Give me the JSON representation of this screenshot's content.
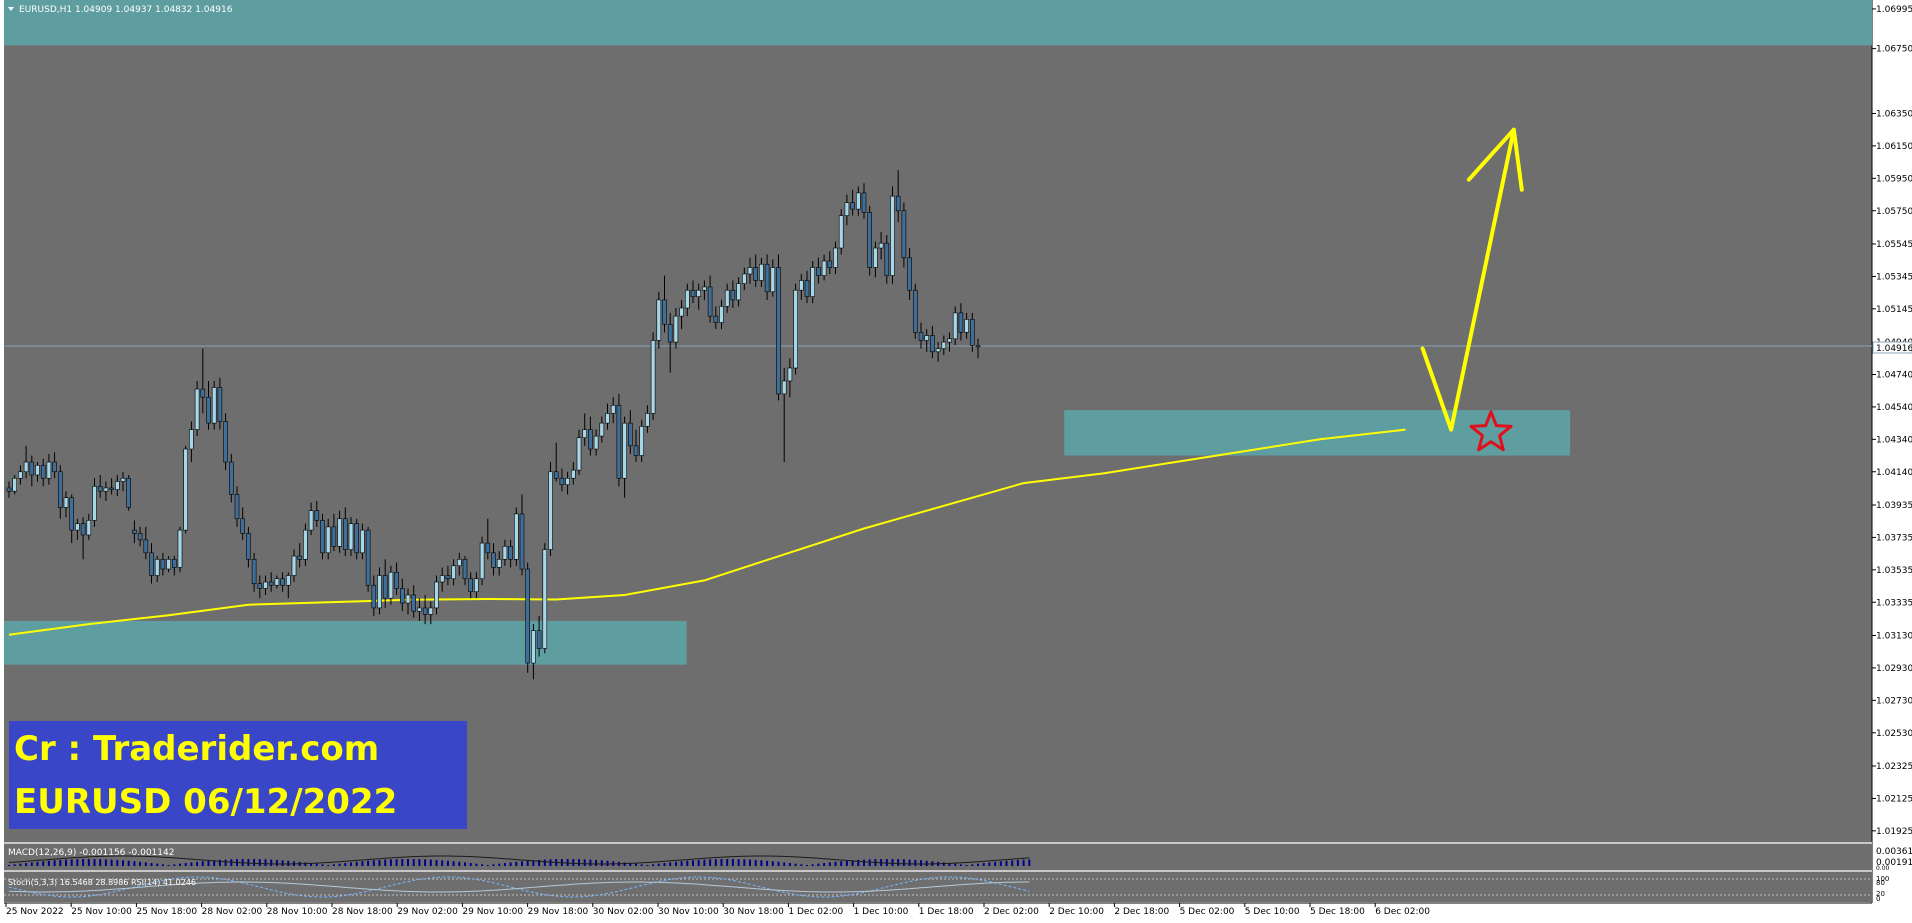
{
  "chart_data": {
    "type": "candlestick",
    "symbol_header": "EURUSD,H1  1.04909 1.04937 1.04832 1.04916",
    "current_price": 1.04916,
    "current_price_label": "1.04916",
    "ylim": [
      1.0185,
      1.0705
    ],
    "y_ticks": [
      "1.06995",
      "1.06750",
      "1.06350",
      "1.06150",
      "1.05950",
      "1.05750",
      "1.05545",
      "1.05345",
      "1.05145",
      "1.04940",
      "1.04740",
      "1.04540",
      "1.04340",
      "1.04140",
      "1.03935",
      "1.03735",
      "1.03535",
      "1.03335",
      "1.03130",
      "1.02930",
      "1.02730",
      "1.02530",
      "1.02325",
      "1.02125",
      "1.01925"
    ],
    "x_ticks": [
      "25 Nov 2022",
      "25 Nov 10:00",
      "25 Nov 18:00",
      "28 Nov 02:00",
      "28 Nov 10:00",
      "28 Nov 18:00",
      "29 Nov 02:00",
      "29 Nov 10:00",
      "29 Nov 18:00",
      "30 Nov 02:00",
      "30 Nov 10:00",
      "30 Nov 18:00",
      "1 Dec 02:00",
      "1 Dec 10:00",
      "1 Dec 18:00",
      "2 Dec 02:00",
      "2 Dec 10:00",
      "2 Dec 18:00",
      "5 Dec 02:00",
      "5 Dec 10:00",
      "5 Dec 18:00",
      "6 Dec 02:00"
    ],
    "bars_total": 180,
    "candles": [
      [
        1.0404,
        1.0408,
        1.0398,
        1.0402
      ],
      [
        1.0402,
        1.0412,
        1.04,
        1.041
      ],
      [
        1.041,
        1.0418,
        1.0406,
        1.0414
      ],
      [
        1.0414,
        1.043,
        1.041,
        1.042
      ],
      [
        1.042,
        1.0424,
        1.0405,
        1.0412
      ],
      [
        1.0412,
        1.042,
        1.0408,
        1.0418
      ],
      [
        1.0418,
        1.0422,
        1.0405,
        1.041
      ],
      [
        1.041,
        1.0425,
        1.0406,
        1.042
      ],
      [
        1.042,
        1.0426,
        1.041,
        1.0414
      ],
      [
        1.0414,
        1.0418,
        1.0385,
        1.0392
      ],
      [
        1.0392,
        1.0402,
        1.0386,
        1.0398
      ],
      [
        1.0398,
        1.04,
        1.037,
        1.0378
      ],
      [
        1.0378,
        1.0385,
        1.0372,
        1.0382
      ],
      [
        1.0382,
        1.0386,
        1.036,
        1.0375
      ],
      [
        1.0375,
        1.0388,
        1.0372,
        1.0384
      ],
      [
        1.0384,
        1.041,
        1.038,
        1.0405
      ],
      [
        1.0405,
        1.0412,
        1.0398,
        1.0402
      ],
      [
        1.0402,
        1.0408,
        1.0396,
        1.0404
      ],
      [
        1.0404,
        1.041,
        1.04,
        1.0403
      ],
      [
        1.0403,
        1.0412,
        1.0399,
        1.0408
      ],
      [
        1.0408,
        1.0414,
        1.0402,
        1.041
      ],
      [
        1.041,
        1.0412,
        1.039,
        1.0392
      ],
      [
        1.0378,
        1.0384,
        1.037,
        1.0376
      ],
      [
        1.0376,
        1.038,
        1.0368,
        1.0372
      ],
      [
        1.0372,
        1.038,
        1.036,
        1.0364
      ],
      [
        1.0364,
        1.037,
        1.0345,
        1.035
      ],
      [
        1.035,
        1.0362,
        1.0346,
        1.036
      ],
      [
        1.036,
        1.0364,
        1.035,
        1.0354
      ],
      [
        1.0354,
        1.0362,
        1.0352,
        1.036
      ],
      [
        1.036,
        1.0362,
        1.035,
        1.0355
      ],
      [
        1.0355,
        1.038,
        1.0352,
        1.0378
      ],
      [
        1.0378,
        1.043,
        1.0376,
        1.0428
      ],
      [
        1.0428,
        1.0445,
        1.042,
        1.044
      ],
      [
        1.044,
        1.047,
        1.0436,
        1.0465
      ],
      [
        1.0465,
        1.049,
        1.045,
        1.046
      ],
      [
        1.046,
        1.047,
        1.044,
        1.0444
      ],
      [
        1.0444,
        1.047,
        1.044,
        1.0466
      ],
      [
        1.0466,
        1.0472,
        1.044,
        1.0445
      ],
      [
        1.0445,
        1.045,
        1.0415,
        1.042
      ],
      [
        1.042,
        1.0425,
        1.0395,
        1.04
      ],
      [
        1.04,
        1.0405,
        1.038,
        1.0385
      ],
      [
        1.0385,
        1.0392,
        1.0372,
        1.0376
      ],
      [
        1.0376,
        1.038,
        1.0355,
        1.036
      ],
      [
        1.036,
        1.0364,
        1.034,
        1.0345
      ],
      [
        1.0345,
        1.035,
        1.0336,
        1.0342
      ],
      [
        1.0342,
        1.035,
        1.0338,
        1.0346
      ],
      [
        1.0346,
        1.0352,
        1.034,
        1.0344
      ],
      [
        1.0344,
        1.035,
        1.0342,
        1.0348
      ],
      [
        1.0348,
        1.0352,
        1.034,
        1.0344
      ],
      [
        1.0344,
        1.0352,
        1.0336,
        1.035
      ],
      [
        1.035,
        1.0366,
        1.0346,
        1.0362
      ],
      [
        1.0362,
        1.037,
        1.0355,
        1.036
      ],
      [
        1.036,
        1.0382,
        1.0356,
        1.0378
      ],
      [
        1.0378,
        1.0395,
        1.0375,
        1.039
      ],
      [
        1.039,
        1.0396,
        1.038,
        1.0384
      ],
      [
        1.0384,
        1.0388,
        1.036,
        1.0364
      ],
      [
        1.0364,
        1.0385,
        1.036,
        1.038
      ],
      [
        1.038,
        1.0388,
        1.0365,
        1.0368
      ],
      [
        1.0368,
        1.039,
        1.0364,
        1.0385
      ],
      [
        1.0385,
        1.0392,
        1.0362,
        1.0366
      ],
      [
        1.0366,
        1.0386,
        1.0362,
        1.0382
      ],
      [
        1.0382,
        1.0385,
        1.036,
        1.0364
      ],
      [
        1.0364,
        1.0382,
        1.036,
        1.0378
      ],
      [
        1.0378,
        1.038,
        1.034,
        1.0344
      ],
      [
        1.0344,
        1.035,
        1.0325,
        1.033
      ],
      [
        1.033,
        1.0355,
        1.0326,
        1.035
      ],
      [
        1.035,
        1.036,
        1.033,
        1.0336
      ],
      [
        1.0336,
        1.0356,
        1.0332,
        1.0352
      ],
      [
        1.0352,
        1.0358,
        1.0338,
        1.0342
      ],
      [
        1.0342,
        1.0348,
        1.0328,
        1.0333
      ],
      [
        1.0333,
        1.0342,
        1.0326,
        1.0338
      ],
      [
        1.0338,
        1.0344,
        1.0324,
        1.0328
      ],
      [
        1.0328,
        1.0336,
        1.0322,
        1.033
      ],
      [
        1.033,
        1.0338,
        1.032,
        1.0326
      ],
      [
        1.0326,
        1.0334,
        1.032,
        1.033
      ],
      [
        1.033,
        1.035,
        1.0326,
        1.0346
      ],
      [
        1.0346,
        1.0355,
        1.034,
        1.035
      ],
      [
        1.035,
        1.0356,
        1.0344,
        1.0348
      ],
      [
        1.0348,
        1.036,
        1.0344,
        1.0356
      ],
      [
        1.0356,
        1.0364,
        1.035,
        1.036
      ],
      [
        1.036,
        1.0362,
        1.0344,
        1.0348
      ],
      [
        1.0348,
        1.0352,
        1.0336,
        1.034
      ],
      [
        1.034,
        1.0352,
        1.0336,
        1.0348
      ],
      [
        1.0348,
        1.0374,
        1.0344,
        1.037
      ],
      [
        1.037,
        1.0385,
        1.036,
        1.0364
      ],
      [
        1.0364,
        1.037,
        1.035,
        1.0355
      ],
      [
        1.0355,
        1.0365,
        1.035,
        1.036
      ],
      [
        1.036,
        1.0372,
        1.0356,
        1.0368
      ],
      [
        1.0368,
        1.0372,
        1.0355,
        1.036
      ],
      [
        1.036,
        1.0392,
        1.0356,
        1.0388
      ],
      [
        1.0388,
        1.04,
        1.035,
        1.0354
      ],
      [
        1.0354,
        1.0358,
        1.029,
        1.0296
      ],
      [
        1.0296,
        1.032,
        1.0286,
        1.0316
      ],
      [
        1.0316,
        1.0325,
        1.03,
        1.0305
      ],
      [
        1.0305,
        1.037,
        1.0302,
        1.0366
      ],
      [
        1.0366,
        1.042,
        1.0362,
        1.0414
      ],
      [
        1.0414,
        1.0432,
        1.0408,
        1.041
      ],
      [
        1.041,
        1.0416,
        1.0402,
        1.0406
      ],
      [
        1.0406,
        1.0414,
        1.04,
        1.041
      ],
      [
        1.041,
        1.042,
        1.0406,
        1.0415
      ],
      [
        1.0415,
        1.044,
        1.0412,
        1.0435
      ],
      [
        1.0435,
        1.045,
        1.043,
        1.044
      ],
      [
        1.044,
        1.0448,
        1.0424,
        1.0428
      ],
      [
        1.0428,
        1.044,
        1.0424,
        1.0436
      ],
      [
        1.0436,
        1.0448,
        1.0432,
        1.0444
      ],
      [
        1.0444,
        1.0456,
        1.044,
        1.045
      ],
      [
        1.045,
        1.046,
        1.0444,
        1.0455
      ],
      [
        1.0455,
        1.0462,
        1.0405,
        1.041
      ],
      [
        1.041,
        1.0448,
        1.0398,
        1.0444
      ],
      [
        1.0444,
        1.0452,
        1.0425,
        1.043
      ],
      [
        1.043,
        1.044,
        1.042,
        1.0424
      ],
      [
        1.0424,
        1.0446,
        1.042,
        1.0442
      ],
      [
        1.0442,
        1.0455,
        1.0438,
        1.045
      ],
      [
        1.045,
        1.05,
        1.0446,
        1.0495
      ],
      [
        1.0495,
        1.0525,
        1.049,
        1.052
      ],
      [
        1.052,
        1.0535,
        1.05,
        1.0505
      ],
      [
        1.0505,
        1.0512,
        1.0475,
        1.0494
      ],
      [
        1.0494,
        1.0515,
        1.049,
        1.051
      ],
      [
        1.051,
        1.052,
        1.0502,
        1.0515
      ],
      [
        1.0515,
        1.053,
        1.051,
        1.0526
      ],
      [
        1.0526,
        1.0532,
        1.0518,
        1.0522
      ],
      [
        1.0522,
        1.053,
        1.0514,
        1.0526
      ],
      [
        1.0526,
        1.0532,
        1.052,
        1.0528
      ],
      [
        1.0528,
        1.0535,
        1.0506,
        1.051
      ],
      [
        1.051,
        1.0516,
        1.0502,
        1.0506
      ],
      [
        1.0506,
        1.052,
        1.0502,
        1.0516
      ],
      [
        1.0516,
        1.053,
        1.0512,
        1.0526
      ],
      [
        1.0526,
        1.0532,
        1.0515,
        1.052
      ],
      [
        1.052,
        1.0534,
        1.0516,
        1.053
      ],
      [
        1.053,
        1.054,
        1.0526,
        1.0536
      ],
      [
        1.0536,
        1.0546,
        1.053,
        1.054
      ],
      [
        1.054,
        1.0548,
        1.0528,
        1.0532
      ],
      [
        1.0532,
        1.0546,
        1.0528,
        1.0542
      ],
      [
        1.0542,
        1.0548,
        1.052,
        1.0525
      ],
      [
        1.0525,
        1.0545,
        1.0522,
        1.054
      ],
      [
        1.054,
        1.0548,
        1.0458,
        1.0462
      ],
      [
        1.0462,
        1.0478,
        1.042,
        1.047
      ],
      [
        1.047,
        1.0484,
        1.046,
        1.0478
      ],
      [
        1.0478,
        1.053,
        1.0474,
        1.0526
      ],
      [
        1.0526,
        1.0536,
        1.052,
        1.0532
      ],
      [
        1.0532,
        1.0538,
        1.0518,
        1.0522
      ],
      [
        1.0522,
        1.0544,
        1.0518,
        1.054
      ],
      [
        1.054,
        1.0546,
        1.053,
        1.0535
      ],
      [
        1.0535,
        1.0548,
        1.0532,
        1.0544
      ],
      [
        1.0544,
        1.055,
        1.0536,
        1.054
      ],
      [
        1.054,
        1.0556,
        1.0536,
        1.0552
      ],
      [
        1.0552,
        1.0576,
        1.0548,
        1.0572
      ],
      [
        1.0572,
        1.0585,
        1.0566,
        1.058
      ],
      [
        1.058,
        1.0588,
        1.0572,
        1.0576
      ],
      [
        1.0576,
        1.059,
        1.0572,
        1.0586
      ],
      [
        1.0586,
        1.0592,
        1.057,
        1.0574
      ],
      [
        1.0574,
        1.0578,
        1.0535,
        1.054
      ],
      [
        1.054,
        1.0556,
        1.0534,
        1.0552
      ],
      [
        1.0552,
        1.0562,
        1.0545,
        1.0555
      ],
      [
        1.0555,
        1.056,
        1.053,
        1.0535
      ],
      [
        1.0535,
        1.059,
        1.053,
        1.0584
      ],
      [
        1.0584,
        1.06,
        1.0568,
        1.0575
      ],
      [
        1.0575,
        1.058,
        1.054,
        1.0546
      ],
      [
        1.0546,
        1.0552,
        1.052,
        1.0526
      ],
      [
        1.0526,
        1.053,
        1.0496,
        1.05
      ],
      [
        1.05,
        1.0506,
        1.049,
        1.0495
      ],
      [
        1.0495,
        1.0502,
        1.0488,
        1.0498
      ],
      [
        1.0498,
        1.0504,
        1.0484,
        1.0488
      ],
      [
        1.0488,
        1.0494,
        1.0482,
        1.049
      ],
      [
        1.049,
        1.0498,
        1.0486,
        1.0494
      ],
      [
        1.0494,
        1.05,
        1.0488,
        1.0496
      ],
      [
        1.0496,
        1.0516,
        1.0492,
        1.0512
      ],
      [
        1.0512,
        1.0518,
        1.0495,
        1.05
      ],
      [
        1.05,
        1.0512,
        1.0496,
        1.0508
      ],
      [
        1.0508,
        1.0512,
        1.0488,
        1.0492
      ],
      [
        1.0492,
        1.0496,
        1.0484,
        1.0491
      ]
    ],
    "moving_average": [
      [
        0,
        1.03135
      ],
      [
        14,
        1.032
      ],
      [
        28,
        1.03255
      ],
      [
        42,
        1.0332
      ],
      [
        56,
        1.03335
      ],
      [
        70,
        1.0335
      ],
      [
        84,
        1.03355
      ],
      [
        96,
        1.03352
      ],
      [
        108,
        1.0338
      ],
      [
        122,
        1.0347
      ],
      [
        136,
        1.0363
      ],
      [
        150,
        1.0379
      ],
      [
        164,
        1.0393
      ],
      [
        178,
        1.0407
      ],
      [
        192,
        1.0413
      ],
      [
        210,
        1.0423
      ],
      [
        230,
        1.0434
      ],
      [
        245,
        1.044
      ]
    ],
    "zones": [
      {
        "x_from_bar": 0,
        "x_to_bar": 999,
        "y_top": 1.0705,
        "y_bottom": 1.0677
      },
      {
        "x_from_bar": 0,
        "x_to_bar": 118,
        "y_top": 1.0322,
        "y_bottom": 1.0295
      },
      {
        "x_from_bar": 186,
        "x_to_bar": 273,
        "y_top": 1.0452,
        "y_bottom": 1.0424
      }
    ],
    "arrow_path": [
      [
        248,
        1.049
      ],
      [
        253,
        1.044
      ],
      [
        264,
        1.0625
      ]
    ],
    "star_marker": {
      "bar": 260,
      "y": 1.0438
    },
    "macd_label": "MACD(12,26,9) -0.001156 -0.001142",
    "macd_values": [
      "0.00361",
      "0.00191",
      "0.00"
    ],
    "stoch_label": "Stoch(5,3,3) 16.5468 28.8986  RSI(14) 41.0246",
    "stoch_values": [
      "100",
      "80",
      "20",
      "0"
    ],
    "annotation_line1": "Cr : Traderider.com",
    "annotation_line2": "EURUSD 06/12/2022",
    "colors": {
      "background": "#6e6e6e",
      "candle_bull": "#a6d7e9",
      "candle_bear": "#3f6f99",
      "ma": "#ffff00",
      "zone": "#5f9ea0",
      "macd_bar": "#00008b",
      "label_box": "#3a46c8",
      "label_text": "#ffff00",
      "star": "#e0101a"
    }
  }
}
